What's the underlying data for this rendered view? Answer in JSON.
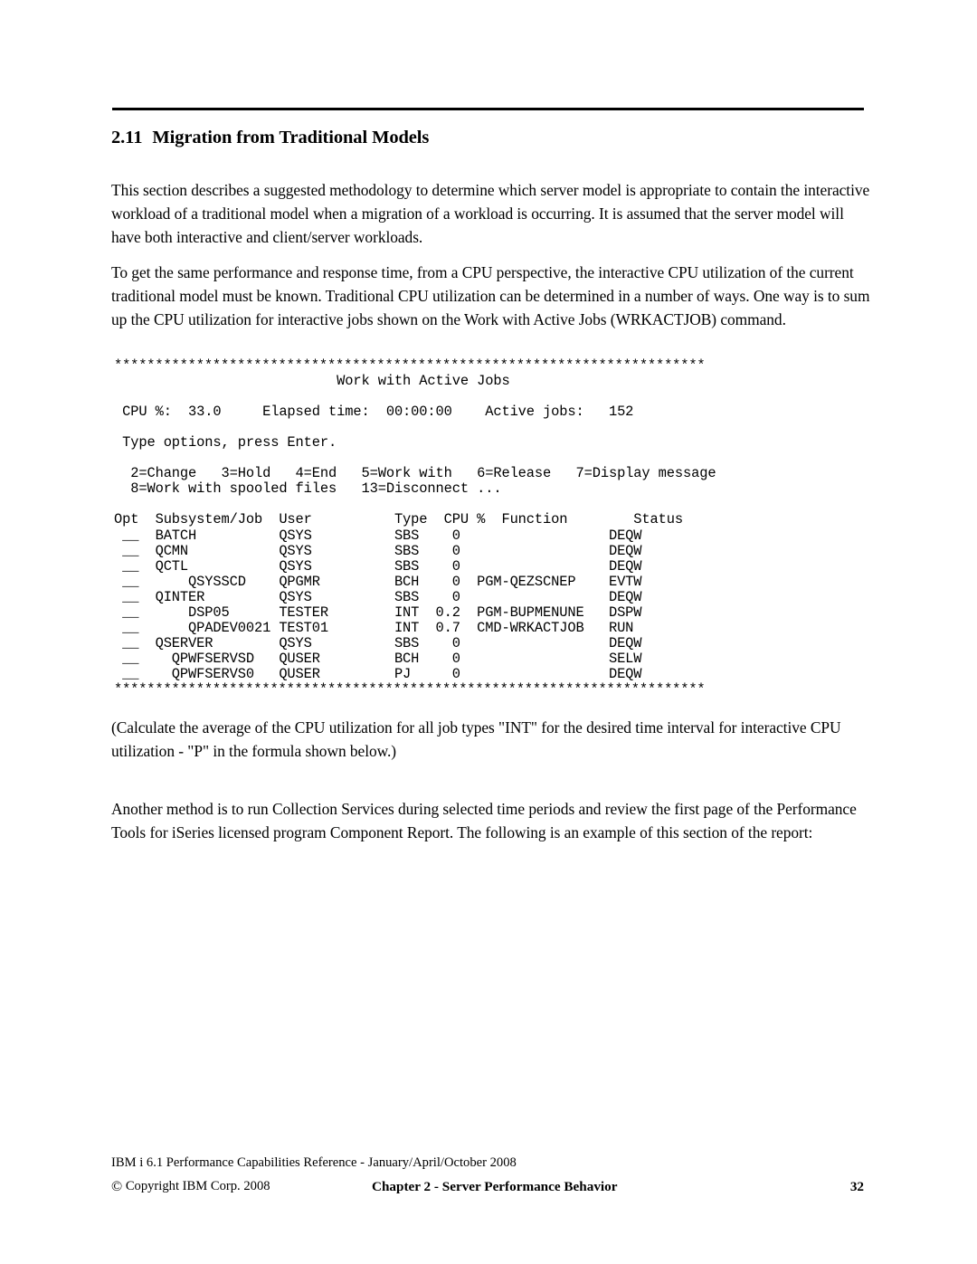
{
  "document": {
    "heading_number": "2.11",
    "heading_title": "Migration from Traditional Models",
    "paragraphs": {
      "p1": "This section describes a suggested methodology  to determine which server model is appropriate to contain the interactive workload of a traditional model when a migration of a workload is occurring. It is assumed that the server model will have both interactive and client/server workloads.",
      "p2": "To get the same performance and response time, from a CPU perspective, the interactive CPU utilization of the current traditional model must be known. Traditional CPU utilization can be determined in a number of ways. One way is to sum up the CPU utilization for interactive jobs shown on the Work with Active Jobs (WRKACTJOB) command.",
      "p3": "(Calculate the average of the CPU  utilization for all job types \"INT\" for the desired time interval for interactive CPU utilization - \"P\" in the formula shown below.)",
      "p4": "Another method is to run Collection Services during selected time periods and review the first page of the Performance Tools for iSeries licensed program Component Report. The following is an example of this section of the report:"
    }
  },
  "terminal": {
    "top_separator": "************************************************************************",
    "bottom_separator": "************************************************************************",
    "screen_title": "Work with Active Jobs",
    "status_line": {
      "cpu_label": "CPU %:",
      "cpu_value": "33.0",
      "elapsed_label": "Elapsed time:",
      "elapsed_value": "00:00:00",
      "active_jobs_label": "Active jobs:",
      "active_jobs_value": "152",
      "raw": " CPU %:   33.0     Elapsed time:   00:00:00    Active jobs:   152"
    },
    "prompt": "Type options, press Enter.",
    "options_line1": "  2=Change   3=Hold   4=End   5=Work with   6=Release   7=Display message",
    "options_line2": "  8=Work with spooled files   13=Disconnect ...",
    "columns": {
      "opt": "Opt",
      "subsystem_job": "Subsystem/Job",
      "user": "User",
      "type": "Type",
      "cpu_pct": "CPU %",
      "function": "Function",
      "status": "Status"
    },
    "header_raw": "Opt  Subsystem/Job  User       Type  CPU %  Function       Status",
    "opt_field": "__",
    "rows": [
      {
        "opt": "__",
        "subsystem_job": "BATCH",
        "indent": 0,
        "user": "QSYS",
        "type": "SBS",
        "cpu": "0",
        "function": "",
        "status": "DEQW"
      },
      {
        "opt": "__",
        "subsystem_job": "QCMN",
        "indent": 0,
        "user": "QSYS",
        "type": "SBS",
        "cpu": "0",
        "function": "",
        "status": "DEQW"
      },
      {
        "opt": "__",
        "subsystem_job": "QCTL",
        "indent": 0,
        "user": "QSYS",
        "type": "SBS",
        "cpu": "0",
        "function": "",
        "status": "DEQW"
      },
      {
        "opt": "__",
        "subsystem_job": "QSYSSCD",
        "indent": 2,
        "user": "QPGMR",
        "type": "BCH",
        "cpu": "0",
        "function": "PGM-QEZSCNEP",
        "status": "EVTW"
      },
      {
        "opt": "__",
        "subsystem_job": "QINTER",
        "indent": 0,
        "user": "QSYS",
        "type": "SBS",
        "cpu": "0",
        "function": "",
        "status": "DEQW"
      },
      {
        "opt": "__",
        "subsystem_job": "DSP05",
        "indent": 2,
        "user": "TESTER",
        "type": "INT",
        "cpu": "0.2",
        "function": "PGM-BUPMENUNE",
        "status": "DSPW"
      },
      {
        "opt": "__",
        "subsystem_job": "QPADEV0021",
        "indent": 2,
        "user": "TEST01",
        "type": "INT",
        "cpu": "0.7",
        "function": "CMD-WRKACTJOB",
        "status": "RUN"
      },
      {
        "opt": "__",
        "subsystem_job": "QSERVER",
        "indent": 0,
        "user": "QSYS",
        "type": "SBS",
        "cpu": "0",
        "function": "",
        "status": "DEQW"
      },
      {
        "opt": "__",
        "subsystem_job": "QPWFSERVSD",
        "indent": 1,
        "user": "QUSER",
        "type": "BCH",
        "cpu": "0",
        "function": "",
        "status": "SELW"
      },
      {
        "opt": "__",
        "subsystem_job": "QPWFSERVS0",
        "indent": 1,
        "user": "QUSER",
        "type": "PJ",
        "cpu": "0",
        "function": "",
        "status": "DEQW"
      }
    ]
  },
  "footer": {
    "reference": "IBM i 6.1 Performance Capabilities Reference - January/April/October 2008",
    "copyright_symbol": "©",
    "copyright": "Copyright IBM Corp. 2008",
    "chapter": "Chapter 2 - Server Performance Behavior",
    "page_number": "32"
  }
}
